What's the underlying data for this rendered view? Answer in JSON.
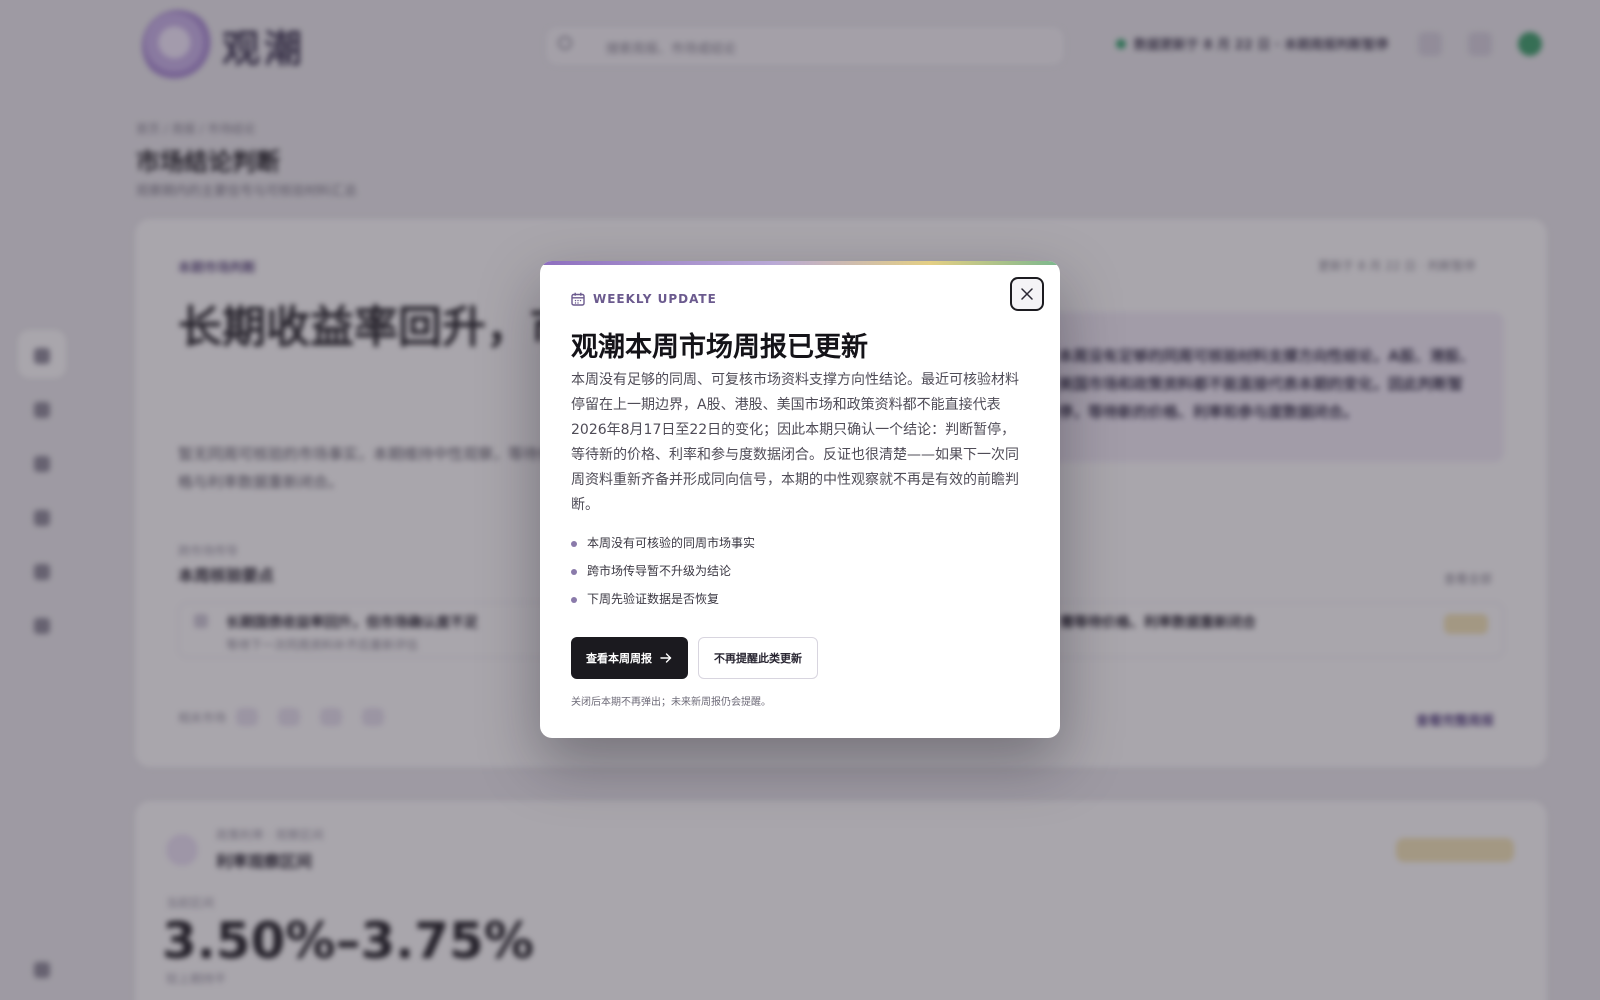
{
  "background": {
    "logo_text": "观潮",
    "search_placeholder": "搜索周报、市场或结论",
    "status_text": "数据更新于 8 月 22 日 · 本期周报判断暂停",
    "breadcrumb": "首页 / 周报 / 市场结论",
    "page_title": "市场结论判断",
    "page_subtitle": "观察期内的主要信号与可核验材料汇总",
    "card": {
      "eyebrow": "本期市场判断",
      "meta": "更新于 8 月 22 日 · 判断暂停",
      "headline": "长期收益率回升，市场确认",
      "lede": "暂无同周可核验的市场事实，本期维持中性观察，等待价格与利率数据重新闭合。",
      "quote": "本周没有足够的同周可核验材料支撑方向性结论，A股、港股、美国市场和政策资料都不能直接代表本期的变化，因此判断暂停，等待新的价格、利率和参与度数据闭合。",
      "section_eyebrow": "跨市场传导",
      "section_title": "本周核验要点",
      "section_link": "查看全部",
      "row_title": "长期国债收益率回升，但市场确认度不足",
      "row_subtitle": "等待下一次同周资料补齐后重新评估",
      "row_title_2": "需等待价格、利率数据重新闭合",
      "chip_label": "相关市场",
      "more_link": "查看完整周报"
    },
    "card2": {
      "eyebrow": "政策利率 · 观察区间",
      "title": "利率观察区间",
      "label": "当前区间",
      "value": "3.50%–3.75%",
      "foot": "较上期持平"
    }
  },
  "modal": {
    "eyebrow": "WEEKLY UPDATE",
    "title": "观潮本周市场周报已更新",
    "body": "本周没有足够的同周、可复核市场资料支撑方向性结论。最近可核验材料停留在上一期边界，A股、港股、美国市场和政策资料都不能直接代表2026年8月17日至22日的变化；因此本期只确认一个结论：判断暂停，等待新的价格、利率和参与度数据闭合。反证也很清楚——如果下一次同周资料重新齐备并形成同向信号，本期的中性观察就不再是有效的前瞻判断。",
    "bullets": [
      "本周没有可核验的同周市场事实",
      "跨市场传导暂不升级为结论",
      "下周先验证数据是否恢复"
    ],
    "primary_label": "查看本周周报",
    "secondary_label": "不再提醒此类更新",
    "foot_note": "关闭后本期不再弹出；未来新周报仍会提醒。",
    "colors": {
      "accent": "#6b5a8e",
      "primary_button": "#1b1a1f",
      "gradient_stops": [
        "#8e6fbf",
        "#b9a9d6",
        "#e4cf84",
        "#7bb78e"
      ]
    },
    "icons": [
      "calendar-icon",
      "close-icon",
      "arrow-right-icon"
    ]
  }
}
